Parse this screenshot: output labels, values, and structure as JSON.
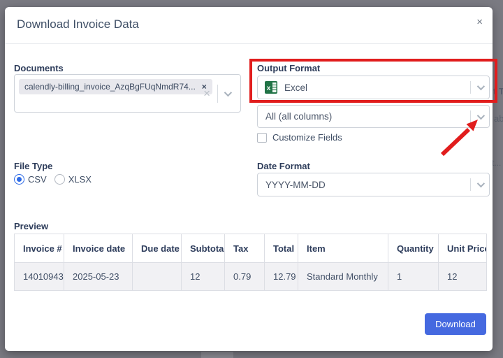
{
  "modal": {
    "title": "Download Invoice Data",
    "close_icon": "×"
  },
  "documents": {
    "label": "Documents",
    "tag": "calendly-billing_invoice_AzqBgFUqNmdR74...",
    "tag_remove_icon": "×",
    "clear_icon": "×"
  },
  "output_format": {
    "label": "Output Format",
    "value": "Excel",
    "icon": "excel-icon"
  },
  "columns_select": {
    "value": "All (all columns)"
  },
  "customize_fields": {
    "label": "Customize Fields",
    "checked": false
  },
  "file_type": {
    "label": "File Type",
    "options": [
      "CSV",
      "XLSX"
    ],
    "selected": "CSV"
  },
  "date_format": {
    "label": "Date Format",
    "value": "YYYY-MM-DD"
  },
  "preview": {
    "label": "Preview",
    "columns": [
      "Invoice #",
      "Invoice date",
      "Due date",
      "Subtotal",
      "Tax",
      "Total",
      "Item",
      "Quantity",
      "Unit Price"
    ],
    "rows": [
      [
        "14010943",
        "2025-05-23",
        "",
        "12",
        "0.79",
        "12.79",
        "Standard Monthly",
        "1",
        "12"
      ]
    ]
  },
  "download_button": {
    "label": "Download"
  },
  "backdrop": {
    "fragments": [
      "t T",
      "ab",
      "t..."
    ]
  },
  "colors": {
    "accent_blue": "#4569e0",
    "excel_green": "#217346",
    "annotation_red": "#e11d1d",
    "backdrop_gray": "#7a7a82"
  }
}
